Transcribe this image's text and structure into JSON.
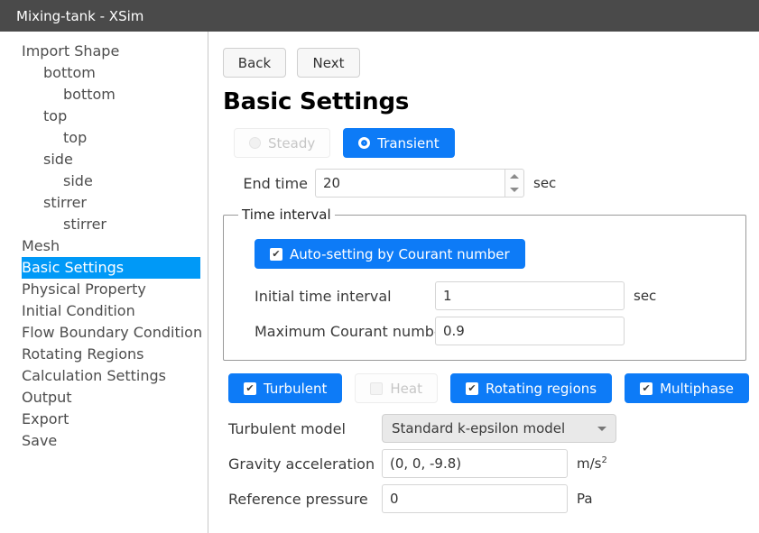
{
  "window": {
    "title": "Mixing-tank - XSim"
  },
  "sidebar": {
    "items": [
      {
        "label": "Import Shape",
        "depth": 0,
        "selected": false
      },
      {
        "label": "bottom",
        "depth": 1,
        "selected": false
      },
      {
        "label": "bottom",
        "depth": 2,
        "selected": false
      },
      {
        "label": "top",
        "depth": 1,
        "selected": false
      },
      {
        "label": "top",
        "depth": 2,
        "selected": false
      },
      {
        "label": "side",
        "depth": 1,
        "selected": false
      },
      {
        "label": "side",
        "depth": 2,
        "selected": false
      },
      {
        "label": "stirrer",
        "depth": 1,
        "selected": false
      },
      {
        "label": "stirrer",
        "depth": 2,
        "selected": false
      },
      {
        "label": "Mesh",
        "depth": 0,
        "selected": false
      },
      {
        "label": "Basic Settings",
        "depth": 0,
        "selected": true
      },
      {
        "label": "Physical Property",
        "depth": 0,
        "selected": false
      },
      {
        "label": "Initial Condition",
        "depth": 0,
        "selected": false
      },
      {
        "label": "Flow Boundary Condition",
        "depth": 0,
        "selected": false
      },
      {
        "label": "Rotating Regions",
        "depth": 0,
        "selected": false
      },
      {
        "label": "Calculation Settings",
        "depth": 0,
        "selected": false
      },
      {
        "label": "Output",
        "depth": 0,
        "selected": false
      },
      {
        "label": "Export",
        "depth": 0,
        "selected": false
      },
      {
        "label": "Save",
        "depth": 0,
        "selected": false
      }
    ]
  },
  "main": {
    "back_label": "Back",
    "next_label": "Next",
    "title": "Basic Settings",
    "mode": {
      "steady_label": "Steady",
      "transient_label": "Transient",
      "selected": "Transient"
    },
    "end_time": {
      "label": "End time",
      "value": "20",
      "unit": "sec"
    },
    "time_interval": {
      "legend": "Time interval",
      "auto_label": "Auto-setting by Courant number",
      "auto_checked": true,
      "initial": {
        "label": "Initial time interval",
        "value": "1",
        "unit": "sec"
      },
      "courant": {
        "label": "Maximum Courant number",
        "value": "0.9"
      }
    },
    "features": [
      {
        "label": "Turbulent",
        "checked": true,
        "enabled": true
      },
      {
        "label": "Heat",
        "checked": false,
        "enabled": false
      },
      {
        "label": "Rotating regions",
        "checked": true,
        "enabled": true
      },
      {
        "label": "Multiphase",
        "checked": true,
        "enabled": true
      }
    ],
    "turbulent_model": {
      "label": "Turbulent model",
      "value": "Standard k-epsilon model"
    },
    "gravity": {
      "label": "Gravity acceleration",
      "value": "(0, 0, -9.8)",
      "unit_base": "m/s",
      "unit_exp": "2"
    },
    "reference_pressure": {
      "label": "Reference pressure",
      "value": "0",
      "unit": "Pa"
    },
    "check_glyph": "✔"
  },
  "colors": {
    "titlebar": "#4a4a4a",
    "sidebar_selected": "#0099f7",
    "button_active": "#0d7bf7"
  }
}
